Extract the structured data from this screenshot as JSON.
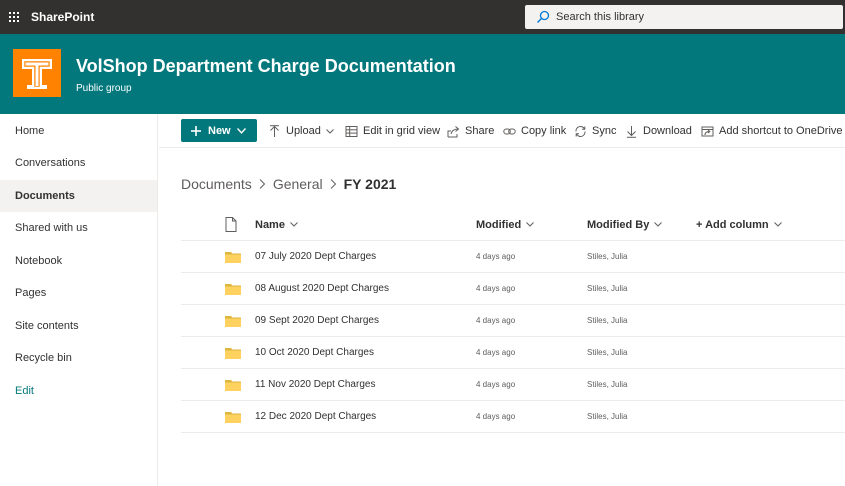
{
  "suitebar": {
    "brand": "SharePoint",
    "search_placeholder": "Search this library",
    "icons": [
      "app-launcher-icon",
      "search-icon"
    ]
  },
  "header": {
    "title": "VolShop Department Charge Documentation",
    "subtitle": "Public group",
    "logo_letter": "T",
    "colors": {
      "header_bg": "#03787c",
      "logo_bg": "#ff8200",
      "suitebar_bg": "#323130"
    }
  },
  "nav": {
    "items": [
      {
        "label": "Home"
      },
      {
        "label": "Conversations"
      },
      {
        "label": "Documents",
        "selected": true
      },
      {
        "label": "Shared with us"
      },
      {
        "label": "Notebook"
      },
      {
        "label": "Pages"
      },
      {
        "label": "Site contents"
      },
      {
        "label": "Recycle bin"
      },
      {
        "label": "Edit"
      }
    ]
  },
  "commandbar": {
    "new_label": "New",
    "upload_label": "Upload",
    "grid_label": "Edit in grid view",
    "share_label": "Share",
    "copylink_label": "Copy link",
    "sync_label": "Sync",
    "download_label": "Download",
    "shortcut_label": "Add shortcut to OneDrive"
  },
  "breadcrumb": {
    "items": [
      "Documents",
      "General",
      "FY 2021"
    ]
  },
  "list": {
    "columns": {
      "name": "Name",
      "modified": "Modified",
      "modified_by": "Modified By",
      "add_column": "+ Add column"
    },
    "rows": [
      {
        "name": "07 July 2020 Dept Charges",
        "modified": "4 days ago",
        "modified_by": "Stiles, Julia"
      },
      {
        "name": "08 August 2020 Dept Charges",
        "modified": "4 days ago",
        "modified_by": "Stiles, Julia"
      },
      {
        "name": "09 Sept 2020 Dept Charges",
        "modified": "4 days ago",
        "modified_by": "Stiles, Julia"
      },
      {
        "name": "10 Oct 2020 Dept Charges",
        "modified": "4 days ago",
        "modified_by": "Stiles, Julia"
      },
      {
        "name": "11 Nov 2020 Dept Charges",
        "modified": "4 days ago",
        "modified_by": "Stiles, Julia"
      },
      {
        "name": "12 Dec 2020 Dept Charges",
        "modified": "4 days ago",
        "modified_by": "Stiles, Julia"
      }
    ]
  }
}
